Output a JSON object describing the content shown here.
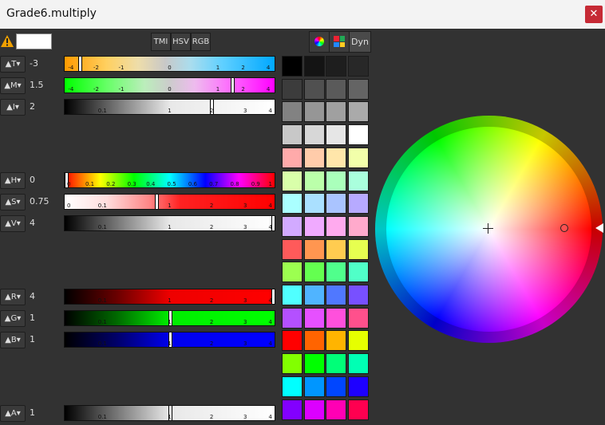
{
  "window": {
    "title": "Grade6.multiply",
    "close_glyph": "✕"
  },
  "toolbar": {
    "warning_glyph": "⚠",
    "current_color": "#ffffff",
    "modes": [
      "TMI",
      "HSV",
      "RGB"
    ],
    "dyn_label": "Dyn"
  },
  "channels": {
    "T": {
      "label": "T",
      "value": "-3"
    },
    "M": {
      "label": "M",
      "value": "1.5"
    },
    "I": {
      "label": "I",
      "value": "2"
    },
    "H": {
      "label": "H",
      "value": "0"
    },
    "S": {
      "label": "S",
      "value": "0.75"
    },
    "V": {
      "label": "V",
      "value": "4"
    },
    "R": {
      "label": "R",
      "value": "4"
    },
    "G": {
      "label": "G",
      "value": "1"
    },
    "B": {
      "label": "B",
      "value": "1"
    },
    "A": {
      "label": "A",
      "value": "1"
    }
  },
  "scales": {
    "tm": [
      "-4",
      "-2",
      "-1",
      "0",
      "1",
      "2",
      "4"
    ],
    "log": [
      "0.1",
      "1",
      "2",
      "3",
      "4"
    ],
    "s": [
      "0",
      "0.1",
      "1",
      "2",
      "3",
      "4"
    ],
    "h": [
      "0",
      "0.1",
      "0.2",
      "0.3",
      "0.4",
      "0.5",
      "0.6",
      "0.7",
      "0.8",
      "0.9",
      "1"
    ]
  },
  "palette": [
    [
      "#000000",
      "#141414",
      "#1e1e1e",
      "#282828"
    ],
    [
      "#3c3c3c",
      "#505050",
      "#5a5a5a",
      "#646464"
    ],
    [
      "#828282",
      "#969696",
      "#a0a0a0",
      "#aaaaaa"
    ],
    [
      "#c8c8c8",
      "#d7d7d7",
      "#e6e6e6",
      "#ffffff"
    ],
    [
      "#ffaaaa",
      "#ffccaa",
      "#ffe6aa",
      "#f2ffaa"
    ],
    [
      "#d9ffaa",
      "#bbffaa",
      "#aaffbb",
      "#aaffdd"
    ],
    [
      "#aaffff",
      "#aae0ff",
      "#aac4ff",
      "#b7aaff"
    ],
    [
      "#d2aaff",
      "#f0aaff",
      "#ffaaee",
      "#ffaacc"
    ],
    [
      "#ff5a5a",
      "#ff9650",
      "#ffcc50",
      "#e6ff50"
    ],
    [
      "#9cff50",
      "#64ff50",
      "#50ff8c",
      "#50ffc8"
    ],
    [
      "#50ffff",
      "#50b4ff",
      "#5078ff",
      "#7850ff"
    ],
    [
      "#b450ff",
      "#e650ff",
      "#ff50dc",
      "#ff508c"
    ],
    [
      "#ff0000",
      "#ff6400",
      "#ffb400",
      "#e6ff00"
    ],
    [
      "#82ff00",
      "#00ff00",
      "#00ff78",
      "#00ffb4"
    ],
    [
      "#00ffff",
      "#0096ff",
      "#0046ff",
      "#1e00ff"
    ],
    [
      "#8200ff",
      "#dc00ff",
      "#ff00b4",
      "#ff0050"
    ]
  ],
  "picker": {
    "hue": 0,
    "saturation": 0.75,
    "value": 4
  }
}
